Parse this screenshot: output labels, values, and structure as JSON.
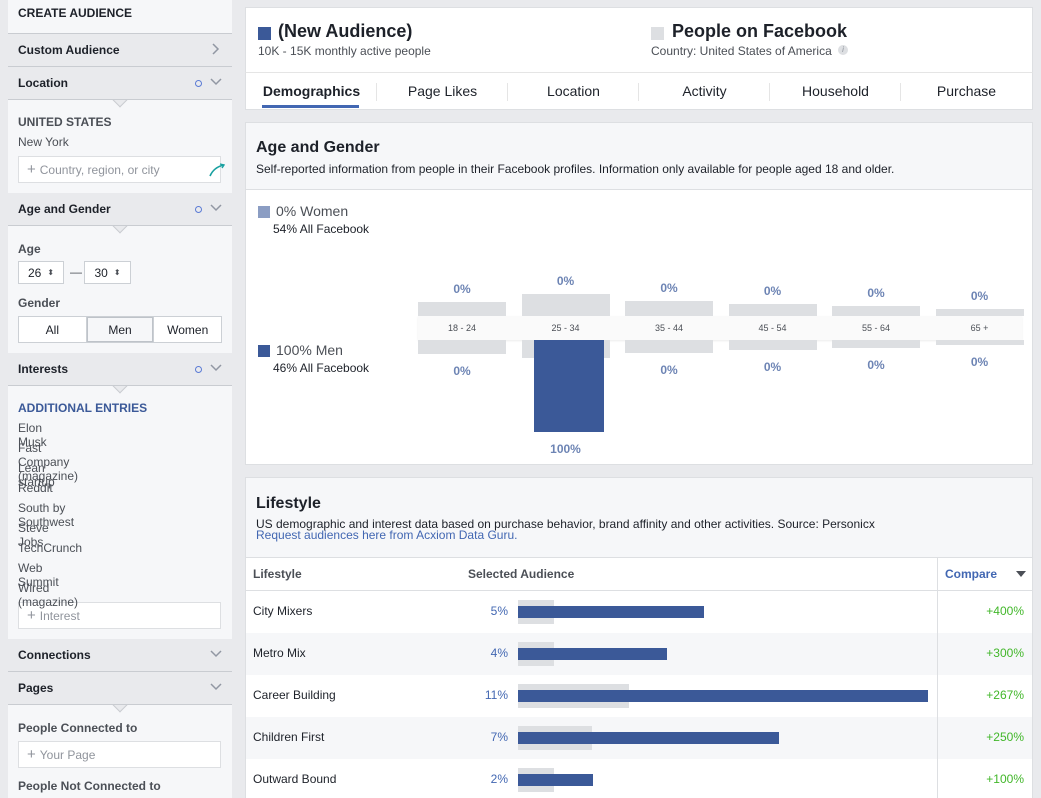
{
  "sidebar": {
    "title": "CREATE AUDIENCE",
    "custom_audience": "Custom Audience",
    "location": {
      "header": "Location",
      "country": "UNITED STATES",
      "city": "New York",
      "placeholder": "Country, region, or city"
    },
    "age_gender": {
      "header": "Age and Gender",
      "age_label": "Age",
      "age_min": "26",
      "age_max": "30",
      "age_sep": "—",
      "gender_label": "Gender",
      "genders": [
        "All",
        "Men",
        "Women"
      ],
      "selected_gender": "Men"
    },
    "interests": {
      "header": "Interests",
      "additional": "ADDITIONAL ENTRIES",
      "items": [
        "Elon Musk",
        "Fast Company (magazine)",
        "Lean startup",
        "Reddit",
        "South by Southwest",
        "Steve Jobs",
        "TechCrunch",
        "Web Summit",
        "Wired (magazine)"
      ],
      "placeholder": "Interest"
    },
    "connections": "Connections",
    "pages": {
      "header": "Pages",
      "connected_to": "People Connected to",
      "placeholder": "Your Page",
      "not_connected_to": "People Not Connected to"
    }
  },
  "header": {
    "audience_title": "(New Audience)",
    "audience_sub": "10K - 15K monthly active people",
    "compare_title": "People on Facebook",
    "compare_sub": "Country: United States of America",
    "audience_color": "#3b5998",
    "compare_color": "#dddfe2"
  },
  "tabs": [
    "Demographics",
    "Page Likes",
    "Location",
    "Activity",
    "Household",
    "Purchase"
  ],
  "active_tab": "Demographics",
  "age_gender": {
    "title": "Age and Gender",
    "description": "Self-reported information from people in their Facebook profiles. Information only available for people aged 18 and older.",
    "women_label": "0% Women",
    "women_sub": "54% All Facebook",
    "men_label": "100% Men",
    "men_sub": "46% All Facebook",
    "women_color": "#8b9dc3",
    "men_color": "#3b5998"
  },
  "chart_data": {
    "type": "bar",
    "categories": [
      "18 - 24",
      "25 - 34",
      "35 - 44",
      "45 - 54",
      "55 - 64",
      "65 +"
    ],
    "series": [
      {
        "name": "Women",
        "values": [
          0,
          0,
          0,
          0,
          0,
          0
        ],
        "labels": [
          "0%",
          "0%",
          "0%",
          "0%",
          "0%",
          "0%"
        ],
        "baseline_facebook": [
          0.24,
          0.36,
          0.25,
          0.2,
          0.16,
          0.12
        ]
      },
      {
        "name": "Men",
        "values": [
          0,
          100,
          0,
          0,
          0,
          0
        ],
        "labels": [
          "0%",
          "100%",
          "0%",
          "0%",
          "0%",
          "0%"
        ],
        "baseline_facebook": [
          0.24,
          0.3,
          0.22,
          0.17,
          0.13,
          0.09
        ]
      }
    ],
    "ylim": [
      0,
      100
    ]
  },
  "lifestyle": {
    "title": "Lifestyle",
    "description": "US demographic and interest data based on purchase behavior, brand affinity and other activities. Source: Personicx",
    "link": "Request audiences here from Acxiom Data Guru.",
    "columns": [
      "Lifestyle",
      "Selected Audience",
      "Compare"
    ],
    "rows": [
      {
        "name": "City Mixers",
        "pct": "5%",
        "value": 5,
        "base": 0.0875,
        "compare": "+400%"
      },
      {
        "name": "Metro Mix",
        "pct": "4%",
        "value": 4,
        "base": 0.0875,
        "compare": "+300%"
      },
      {
        "name": "Career Building",
        "pct": "11%",
        "value": 11,
        "base": 0.27,
        "compare": "+267%"
      },
      {
        "name": "Children First",
        "pct": "7%",
        "value": 7,
        "base": 0.18,
        "compare": "+250%"
      },
      {
        "name": "Outward Bound",
        "pct": "2%",
        "value": 2,
        "base": 0.0875,
        "compare": "+100%"
      }
    ]
  }
}
